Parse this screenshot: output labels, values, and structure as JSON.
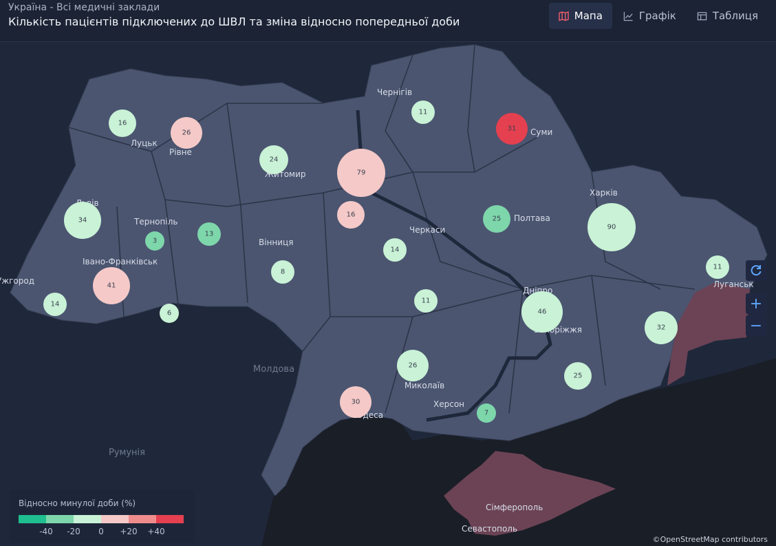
{
  "header": {
    "subtitle": "Україна - Всі медичні заклади",
    "title": "Кількість пацієнтів підключених до ШВЛ та зміна відносно попередньої доби"
  },
  "tabs": [
    {
      "label": "Мапа",
      "icon": "map-icon",
      "active": true
    },
    {
      "label": "Графік",
      "icon": "line-chart-icon",
      "active": false
    },
    {
      "label": "Таблиця",
      "icon": "table-icon",
      "active": false
    }
  ],
  "colors": {
    "c1": "#1fbf8f",
    "c2": "#7ed6ab",
    "c3": "#c9f2d6",
    "c4": "#f4c9c7",
    "c5": "#ef8c8c",
    "c6": "#e4404f",
    "land": "#4b5570",
    "occupied": "#6b4355",
    "sea": "#1c2436"
  },
  "cities": [
    "Чернігів",
    "Суми",
    "Луцьк",
    "Рівне",
    "Житомир",
    "Харків",
    "Львів",
    "Тернопіль",
    "Полтава",
    "Черкаси",
    "Вінниця",
    "Івано-Франківськ",
    "Ужгород",
    "Луганськ",
    "Дніпро",
    "Запоріжжя",
    "Миколаїв",
    "Херсон",
    "Одеса",
    "Сімферополь",
    "Севастополь"
  ],
  "countries": [
    "Молдова",
    "Румунія"
  ],
  "bubbles": [
    {
      "value": "16",
      "color": "c3"
    },
    {
      "value": "26",
      "color": "c4"
    },
    {
      "value": "24",
      "color": "c3"
    },
    {
      "value": "79",
      "color": "c4"
    },
    {
      "value": "11",
      "color": "c3"
    },
    {
      "value": "31",
      "color": "c6"
    },
    {
      "value": "34",
      "color": "c3"
    },
    {
      "value": "3",
      "color": "c2"
    },
    {
      "value": "13",
      "color": "c2"
    },
    {
      "value": "16",
      "color": "c4"
    },
    {
      "value": "14",
      "color": "c3"
    },
    {
      "value": "25",
      "color": "c2"
    },
    {
      "value": "90",
      "color": "c3"
    },
    {
      "value": "41",
      "color": "c4"
    },
    {
      "value": "8",
      "color": "c3"
    },
    {
      "value": "11",
      "color": "c3"
    },
    {
      "value": "14",
      "color": "c3"
    },
    {
      "value": "6",
      "color": "c3"
    },
    {
      "value": "46",
      "color": "c3"
    },
    {
      "value": "11",
      "color": "c3"
    },
    {
      "value": "32",
      "color": "c3"
    },
    {
      "value": "26",
      "color": "c3"
    },
    {
      "value": "25",
      "color": "c3"
    },
    {
      "value": "30",
      "color": "c4"
    },
    {
      "value": "7",
      "color": "c2"
    }
  ],
  "legend": {
    "title": "Відносно минулої доби (%)",
    "ticks": [
      "-40",
      "-20",
      "0",
      "+20",
      "+40"
    ]
  },
  "attribution": "©OpenStreetMap contributors"
}
